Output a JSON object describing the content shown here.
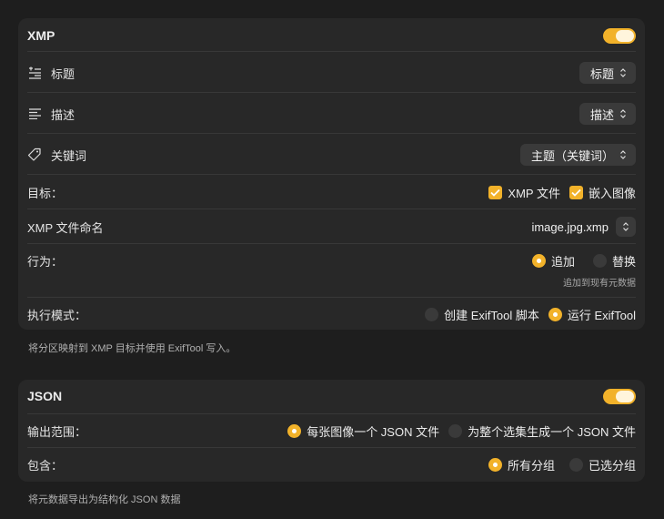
{
  "xmp": {
    "title": "XMP",
    "toggle_on": true,
    "rows": {
      "title": {
        "label": "标题",
        "popup": "标题"
      },
      "description": {
        "label": "描述",
        "popup": "描述"
      },
      "keywords": {
        "label": "关键词",
        "popup": "主题（关键词）"
      },
      "target": {
        "label": "目标：",
        "opt1": "XMP 文件",
        "opt2": "嵌入图像"
      },
      "naming": {
        "label": "XMP 文件命名",
        "value": "image.jpg.xmp"
      },
      "behavior": {
        "label": "行为：",
        "opt1": "追加",
        "opt2": "替换",
        "hint": "追加到现有元数据"
      },
      "mode": {
        "label": "执行模式：",
        "opt1": "创建 ExifTool 脚本",
        "opt2": "运行 ExifTool"
      }
    },
    "caption": "将分区映射到 XMP 目标并使用 ExifTool 写入。"
  },
  "json": {
    "title": "JSON",
    "toggle_on": true,
    "rows": {
      "scope": {
        "label": "输出范围：",
        "opt1": "每张图像一个 JSON 文件",
        "opt2": "为整个选集生成一个 JSON 文件"
      },
      "include": {
        "label": "包含：",
        "opt1": "所有分组",
        "opt2": "已选分组"
      }
    },
    "caption": "将元数据导出为结构化 JSON 数据"
  },
  "colors": {
    "accent": "#f2b22a",
    "panel": "#282828",
    "background": "#1e1e1e"
  }
}
